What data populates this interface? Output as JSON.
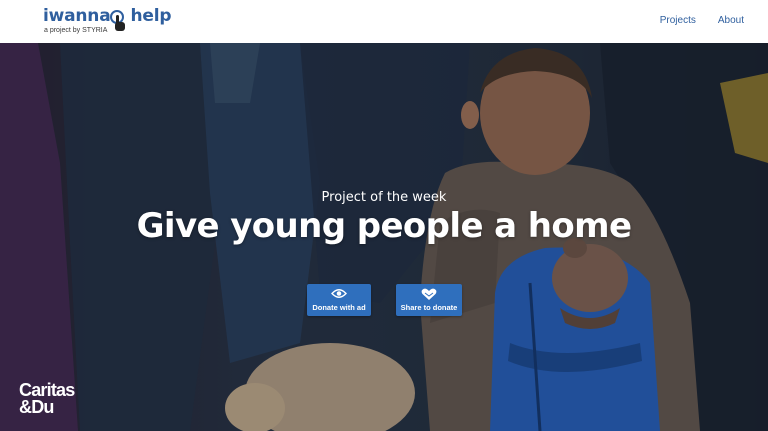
{
  "header": {
    "logo_word1": "iwanna",
    "logo_word2": "help",
    "logo_sub": "a project by STYRIA",
    "nav": [
      {
        "label": "Projects"
      },
      {
        "label": "About"
      }
    ]
  },
  "hero": {
    "subtitle": "Project of the week",
    "title": "Give young people a home",
    "buttons": {
      "donate": {
        "label": "Donate with ad",
        "icon": "eye-icon"
      },
      "share": {
        "label": "Share to donate",
        "icon": "heart-hands-icon"
      }
    },
    "partner_line1": "Caritas",
    "partner_line2": "&Du"
  },
  "colors": {
    "brand_blue": "#2f5f9e",
    "button_blue": "#2f6fbd",
    "backpack_blue": "#2a66c8"
  }
}
